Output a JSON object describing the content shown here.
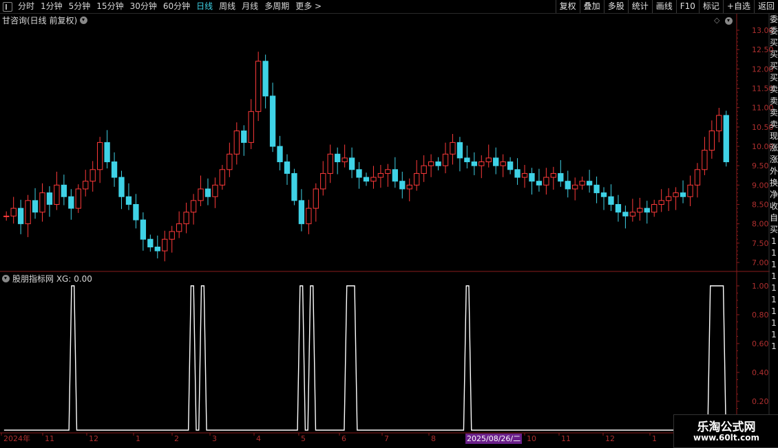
{
  "toolbar": {
    "left_items": [
      "分时",
      "1分钟",
      "5分钟",
      "15分钟",
      "30分钟",
      "60分钟",
      "日线",
      "周线",
      "月线",
      "多周期",
      "更多 >"
    ],
    "active": "日线",
    "right_items": [
      "复权",
      "叠加",
      "多股",
      "统计",
      "画线",
      "F10",
      "标记",
      "+自选",
      "返回"
    ]
  },
  "main_chart": {
    "title": "甘咨询(日线 前复权)",
    "y_ticks": [
      "13.00",
      "12.50",
      "12.00",
      "11.50",
      "11.00",
      "10.50",
      "10.00",
      "9.50",
      "9.00",
      "8.50",
      "8.00",
      "7.50",
      "7.00"
    ]
  },
  "indicator": {
    "title": "股朋指标网 XG: 0.00",
    "y_ticks": [
      "1.00",
      "0.80",
      "0.60",
      "0.40",
      "0.20"
    ]
  },
  "x_axis": {
    "labels": [
      "2024年",
      "11",
      "12",
      "1",
      "2",
      "3",
      "4",
      "5",
      "6",
      "7",
      "8",
      "10",
      "11",
      "12",
      "1"
    ],
    "cursor_date": "2025/08/26/二"
  },
  "side_panel": {
    "chars": [
      "委",
      "委",
      "买",
      "买",
      "买",
      "买",
      "卖",
      "卖",
      "卖",
      "卖",
      "现",
      "涨",
      "涨",
      "外",
      "换",
      "净",
      "收",
      "自",
      "买",
      "1",
      "1",
      "1",
      "1",
      "1",
      "1",
      "1",
      "1",
      "1",
      "1"
    ]
  },
  "watermark": {
    "line1": "乐淘公式网",
    "line2": "www.60lt.com"
  },
  "colors": {
    "up": "#ff3a3a",
    "down": "#3fd2e6",
    "axis": "#8a1c1c",
    "indicator_line": "#ffffff"
  },
  "chart_data": [
    {
      "type": "candlestick",
      "title": "甘咨询(日线 前复权)",
      "ylim": [
        7.0,
        13.0
      ],
      "x_labels": [
        "2024年",
        "11",
        "12",
        "1",
        "2",
        "3",
        "4",
        "5",
        "6",
        "7",
        "8",
        "10",
        "11",
        "12",
        "1"
      ],
      "closes": [
        8.2,
        8.4,
        8.0,
        8.6,
        8.3,
        8.8,
        8.5,
        9.0,
        8.7,
        8.4,
        8.9,
        9.1,
        9.4,
        10.1,
        9.6,
        9.2,
        8.7,
        8.5,
        8.1,
        7.6,
        7.4,
        7.3,
        7.6,
        7.8,
        8.0,
        8.3,
        8.6,
        8.9,
        8.7,
        9.0,
        9.4,
        9.8,
        10.4,
        10.1,
        10.9,
        12.2,
        11.3,
        10.0,
        9.6,
        9.3,
        8.6,
        8.0,
        8.4,
        8.9,
        9.3,
        9.8,
        9.6,
        9.7,
        9.4,
        9.2,
        9.1,
        9.2,
        9.3,
        9.4,
        9.1,
        8.9,
        9.0,
        9.3,
        9.5,
        9.6,
        9.5,
        9.8,
        10.1,
        9.7,
        9.6,
        9.5,
        9.6,
        9.7,
        9.5,
        9.6,
        9.4,
        9.2,
        9.3,
        9.1,
        9.0,
        9.2,
        9.3,
        9.1,
        8.9,
        9.0,
        9.1,
        9.0,
        8.8,
        8.7,
        8.5,
        8.3,
        8.2,
        8.3,
        8.4,
        8.3,
        8.5,
        8.6,
        8.7,
        8.8,
        8.7,
        9.0,
        9.4,
        9.9,
        10.4,
        10.8,
        9.6
      ]
    },
    {
      "type": "line",
      "title": "股朋指标网 XG: 0.00",
      "series": [
        {
          "name": "XG",
          "values": [
            0,
            0,
            0,
            0,
            0,
            0,
            0,
            0,
            0,
            0,
            0,
            0,
            0,
            1,
            0,
            0,
            0,
            0,
            0,
            0,
            0,
            0,
            0,
            0,
            0,
            0,
            0,
            0,
            0,
            0,
            0,
            0,
            0,
            0,
            0,
            0,
            1,
            0,
            1,
            0,
            0,
            0,
            0,
            0,
            0,
            0,
            0,
            0,
            0,
            0,
            0,
            0,
            0,
            0,
            0,
            0,
            0,
            1,
            0,
            1,
            0,
            0,
            0,
            0,
            0,
            0,
            1,
            1,
            0,
            0,
            0,
            0,
            0,
            0,
            0,
            0,
            0,
            0,
            0,
            0,
            0,
            0,
            0,
            0,
            0,
            0,
            0,
            0,
            0,
            1,
            0,
            0,
            0,
            0,
            0,
            0,
            0,
            0,
            0,
            0,
            0,
            0,
            0,
            0,
            0,
            0,
            0,
            0,
            0,
            0,
            0,
            0,
            0,
            0,
            0,
            0,
            0,
            0,
            0,
            0,
            0,
            0,
            0,
            0,
            0,
            0,
            0,
            0,
            0,
            0,
            0,
            0,
            0,
            0,
            0,
            0,
            1,
            1,
            1,
            0
          ]
        }
      ],
      "ylim": [
        0,
        1.0
      ],
      "current_value": 0.0
    }
  ]
}
